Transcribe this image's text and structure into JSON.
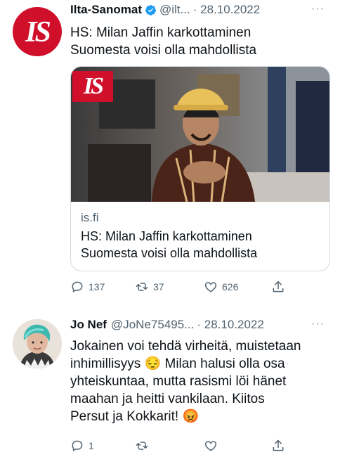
{
  "tweet1": {
    "avatar_text": "IS",
    "author_name": "Ilta-Sanomat",
    "handle": "@ilt...",
    "date": "· 28.10.2022",
    "more": "···",
    "text_lines": [
      "HS: Milan Jaffin karkottaminen",
      "Suomesta voisi olla mahdollista"
    ],
    "card": {
      "badge_text": "IS",
      "domain": "is.fi",
      "title_lines": [
        "HS: Milan Jaffin karkottaminen",
        "Suomesta voisi olla mahdollista"
      ]
    },
    "actions": {
      "reply_count": "137",
      "retweet_count": "37",
      "like_count": "626",
      "share_count": ""
    }
  },
  "tweet2": {
    "author_name": "Jo Nef",
    "handle": "@JoNe75495...",
    "date": "· 28.10.2022",
    "more": "···",
    "text_lines": [
      "Jokainen voi tehdä virheitä, muistetaan",
      "inhimillisyys 😔 Milan halusi olla osa",
      "yhteiskuntaa, mutta rasismi löi hänet",
      "maahan ja heitti vankilaan. Kiitos",
      "Persut ja Kokkarit! 😡"
    ],
    "actions": {
      "reply_count": "1",
      "retweet_count": "",
      "like_count": "",
      "share_count": ""
    }
  },
  "colors": {
    "brand_red": "#d0102b",
    "verified_blue": "#1d9bf0",
    "secondary_text": "#536471",
    "border": "#cfd9de"
  },
  "icons": [
    "verified-badge-icon",
    "reply-icon",
    "retweet-icon",
    "like-icon",
    "share-icon",
    "more-icon"
  ]
}
